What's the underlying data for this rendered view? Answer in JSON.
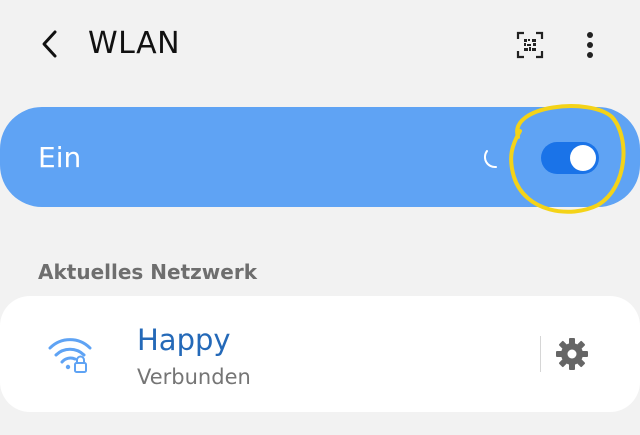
{
  "header": {
    "title": "WLAN",
    "back_icon": "chevron-left-icon",
    "qr_icon": "qr-code-scan-icon",
    "more_icon": "more-vertical-icon"
  },
  "master_switch": {
    "label": "Ein",
    "state": "on",
    "background_color": "#5fa3f4",
    "toggle_color": "#1a73e8",
    "annotation_color": "#f4d318"
  },
  "current_network": {
    "section_title": "Aktuelles Netzwerk",
    "name": "Happy",
    "status": "Verbunden",
    "name_color": "#2469b8",
    "wifi_icon": "wifi-locked-icon",
    "settings_icon": "gear-icon"
  }
}
